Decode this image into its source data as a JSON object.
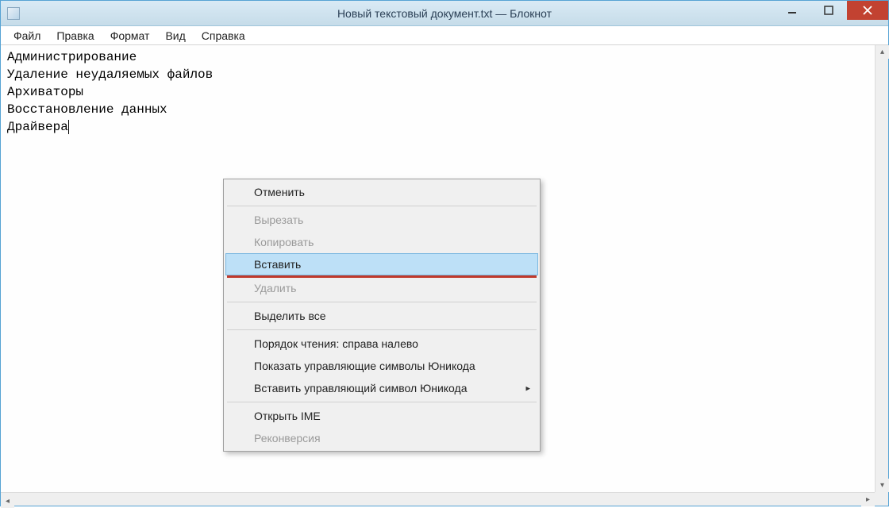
{
  "titlebar": {
    "title": "Новый текстовый документ.txt — Блокнот"
  },
  "menubar": {
    "items": [
      "Файл",
      "Правка",
      "Формат",
      "Вид",
      "Справка"
    ]
  },
  "editor": {
    "lines": [
      "Администрирование",
      "Удаление неудаляемых файлов",
      "Архиваторы",
      "Восстановление данных",
      "Драйвера"
    ]
  },
  "context_menu": {
    "undo": "Отменить",
    "cut": "Вырезать",
    "copy": "Копировать",
    "paste": "Вставить",
    "delete": "Удалить",
    "select_all": "Выделить все",
    "reading_order": "Порядок чтения: справа налево",
    "show_unicode": "Показать управляющие символы Юникода",
    "insert_unicode": "Вставить управляющий символ Юникода",
    "open_ime": "Открыть IME",
    "reconversion": "Реконверсия"
  }
}
